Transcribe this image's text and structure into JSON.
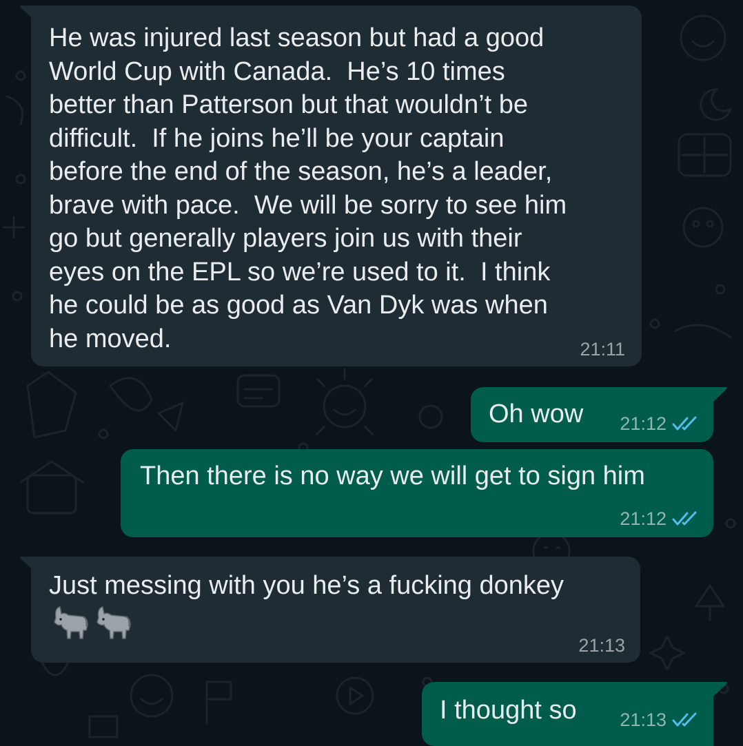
{
  "colors": {
    "background": "#0b141a",
    "incoming_bubble": "#202c33",
    "outgoing_bubble": "#005c4b",
    "text": "#e9edef",
    "read_ticks": "#53bdeb"
  },
  "messages": [
    {
      "direction": "incoming",
      "text": "He was injured last season but had a good\nWorld Cup with Canada.  He’s 10 times\nbetter than Patterson but that wouldn’t be\ndifficult.  If he joins he’ll be your captain\nbefore the end of the season, he’s a leader,\nbrave with pace.  We will be sorry to see him\ngo but generally players join us with their\neyes on the EPL so we’re used to it.  I think\nhe could be as good as Van Dyk was when\nhe moved.",
      "time": "21:11"
    },
    {
      "direction": "outgoing",
      "text": "Oh wow",
      "time": "21:12",
      "status": "read"
    },
    {
      "direction": "outgoing",
      "text": "Then there is no way we will get to sign him",
      "time": "21:12",
      "status": "read"
    },
    {
      "direction": "incoming",
      "text": "Just messing with you he’s a fucking donkey",
      "emojis": [
        "donkey-emoji",
        "donkey-emoji"
      ],
      "time": "21:13"
    },
    {
      "direction": "outgoing",
      "text": "I thought so",
      "time": "21:13",
      "status": "read"
    }
  ]
}
